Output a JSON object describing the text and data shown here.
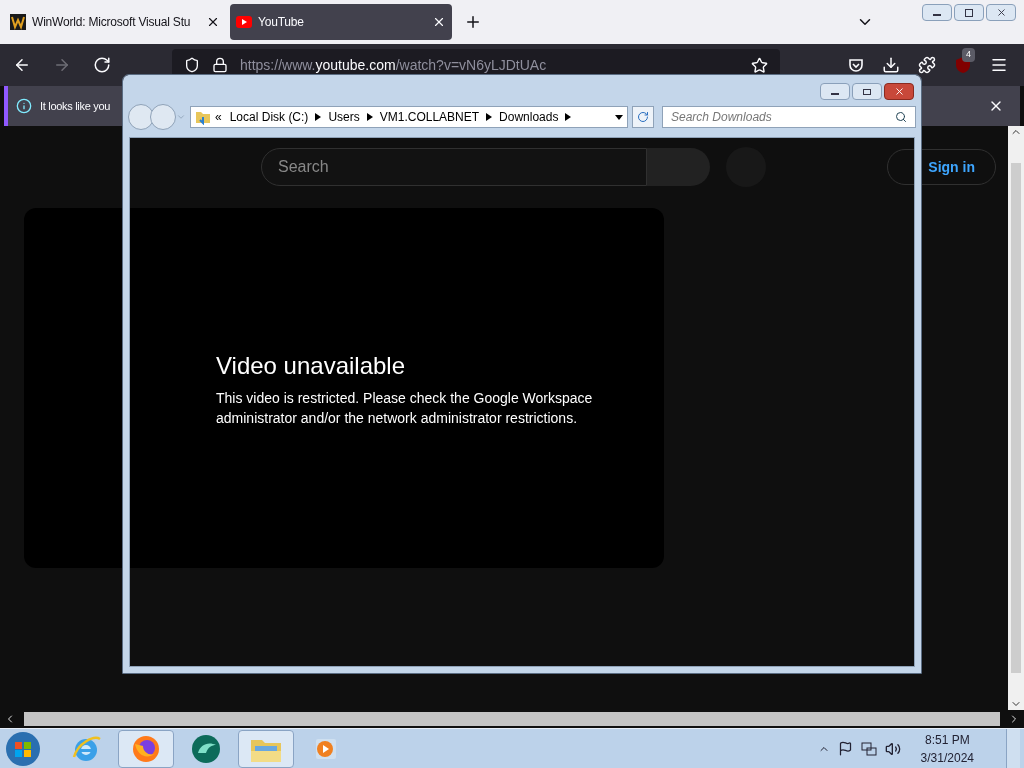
{
  "tabs": [
    {
      "title": "WinWorld: Microsoft Visual Stu",
      "kind": "winworld",
      "selected": false
    },
    {
      "title": "YouTube",
      "kind": "youtube",
      "selected": true
    }
  ],
  "nav_buttons": [
    {
      "kind": "back",
      "disabled": false
    },
    {
      "kind": "forward",
      "disabled": true
    },
    {
      "kind": "reload",
      "disabled": false
    }
  ],
  "url": {
    "scheme": "https://www.",
    "domain": "youtube.com",
    "path": "/watch?v=vN6yLJDtUAc"
  },
  "extension_badge": "4",
  "notification": {
    "text": "It looks like you"
  },
  "youtube": {
    "search_placeholder": "Search",
    "sign_in": "Sign in",
    "video_title": "Video unavailable",
    "video_message": "This video is restricted. Please check the Google Workspace administrator and/or the network administrator restrictions."
  },
  "explorer": {
    "overflow": "«",
    "breadcrumb": [
      "Local Disk (C:)",
      "Users",
      "VM1.COLLABNET",
      "Downloads"
    ],
    "search_placeholder": "Search Downloads"
  },
  "taskbar": [
    {
      "kind": "ie",
      "selected": false
    },
    {
      "kind": "firefox",
      "selected": true
    },
    {
      "kind": "app",
      "selected": false
    },
    {
      "kind": "folder",
      "selected": true
    },
    {
      "kind": "media",
      "selected": false
    }
  ],
  "clock": {
    "time": "8:51 PM",
    "date": "3/31/2024"
  }
}
